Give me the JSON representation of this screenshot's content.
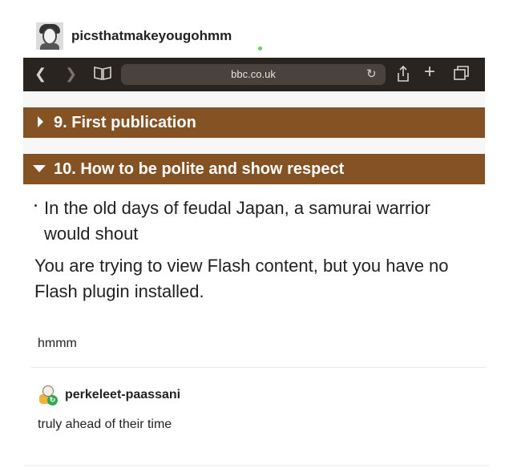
{
  "post": {
    "username": "picsthatmakeyougohmm",
    "caption": "hmmm"
  },
  "browser": {
    "url": "bbc.co.uk"
  },
  "page": {
    "section_9": "9. First publication",
    "section_10": "10. How to be polite and show respect",
    "bullet": "In the old days of feudal Japan, a samurai warrior would shout",
    "flash_message": "You are trying to view Flash content, but you have no Flash plugin installed."
  },
  "reblog": {
    "username": "perkeleet-paassani",
    "comment": "truly ahead of their time"
  },
  "colors": {
    "section_header": "#855224",
    "browser_bar": "#2a2421",
    "online_dot": "#5fd35f"
  }
}
